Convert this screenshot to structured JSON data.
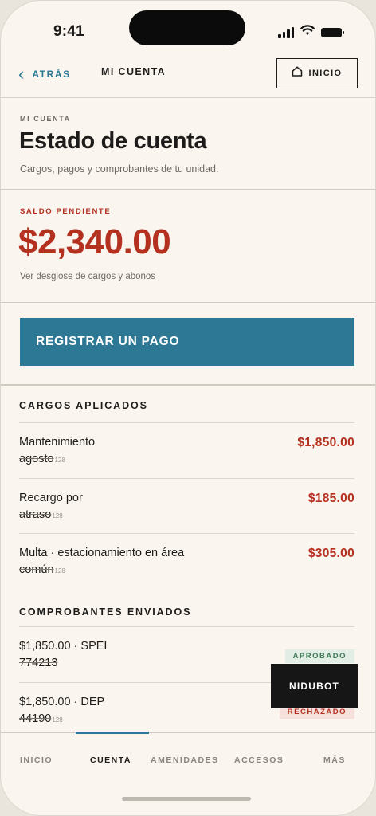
{
  "status_bar": {
    "time": "9:41"
  },
  "header": {
    "back_label": "ATRÁS",
    "title": "MI CUENTA",
    "home_label": "INICIO"
  },
  "page": {
    "eyebrow": "MI CUENTA",
    "title": "Estado de cuenta",
    "subtitle": "Cargos, pagos y comprobantes de tu unidad."
  },
  "balance": {
    "label": "SALDO PENDIENTE",
    "amount": "$2,340.00",
    "link": "Ver desglose de cargos y abonos"
  },
  "cta": {
    "label": "REGISTRAR UN PAGO"
  },
  "charges": {
    "heading": "CARGOS APLICADOS",
    "items": [
      {
        "line1": "Mantenimiento",
        "line2": "agosto",
        "tag": "128",
        "amount": "$1,850.00"
      },
      {
        "line1": "Recargo por",
        "line2": "atraso",
        "tag": "128",
        "amount": "$185.00"
      },
      {
        "line1": "Multa · estacionamiento en área",
        "line2": "común",
        "tag": "128",
        "amount": "$305.00"
      }
    ]
  },
  "receipts": {
    "heading": "COMPROBANTES ENVIADOS",
    "items": [
      {
        "line1": "$1,850.00 · SPEI",
        "line2": "774213",
        "tag": "",
        "status": "APROBADO"
      },
      {
        "line1": "$1,850.00 · DEP",
        "line2": "44190",
        "tag": "128",
        "status": "RECHAZADO"
      }
    ]
  },
  "fab": {
    "label": "NIDUBOT"
  },
  "tabs": [
    {
      "label": "INICIO"
    },
    {
      "label": "CUENTA"
    },
    {
      "label": "AMENIDADES"
    },
    {
      "label": "ACCESOS"
    },
    {
      "label": "MÁS"
    }
  ],
  "colors": {
    "accent": "#2d7894",
    "danger": "#b4301f",
    "background": "#faf5ee",
    "approved": "#3e7b57"
  }
}
